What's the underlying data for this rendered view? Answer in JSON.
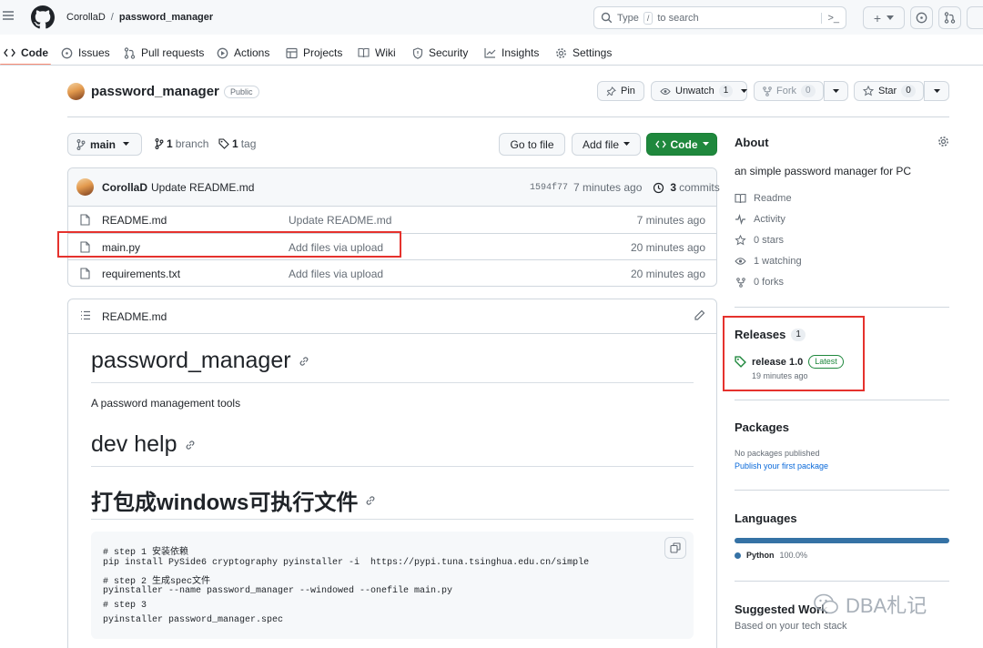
{
  "header": {
    "owner": "CorollaD",
    "separator": "/",
    "repo": "password_manager",
    "search_type": "Type",
    "search_key": "/",
    "search_rest": "to search",
    "terminal_label": ">_",
    "plus_label": "+"
  },
  "tabs": [
    {
      "label": "Code",
      "icon": "code-icon"
    },
    {
      "label": "Issues",
      "icon": "issue-icon"
    },
    {
      "label": "Pull requests",
      "icon": "pull-request-icon"
    },
    {
      "label": "Actions",
      "icon": "play-icon"
    },
    {
      "label": "Projects",
      "icon": "table-icon"
    },
    {
      "label": "Wiki",
      "icon": "book-icon"
    },
    {
      "label": "Security",
      "icon": "shield-icon"
    },
    {
      "label": "Insights",
      "icon": "graph-icon"
    },
    {
      "label": "Settings",
      "icon": "gear-icon"
    }
  ],
  "repo_header": {
    "name": "password_manager",
    "visibility": "Public",
    "pin_label": "Pin",
    "unwatch_label": "Unwatch",
    "unwatch_count": "1",
    "fork_label": "Fork",
    "fork_count": "0",
    "star_label": "Star",
    "star_count": "0"
  },
  "toolbar": {
    "branch_label": "main",
    "branches_count": "1",
    "branches_label": "branch",
    "tags_count": "1",
    "tags_label": "tag",
    "goto_file": "Go to file",
    "add_file": "Add file",
    "code_label": "Code"
  },
  "commit": {
    "author": "CorollaD",
    "message": "Update README.md",
    "hash": "1594f77",
    "time": "7 minutes ago",
    "commits_count": "3",
    "commits_label": "commits"
  },
  "files": [
    {
      "name": "README.md",
      "message": "Update README.md",
      "time": "7 minutes ago"
    },
    {
      "name": "main.py",
      "message": "Add files via upload",
      "time": "20 minutes ago"
    },
    {
      "name": "requirements.txt",
      "message": "Add files via upload",
      "time": "20 minutes ago"
    }
  ],
  "readme": {
    "file_label": "README.md",
    "h1": "password_manager",
    "p1": "A password management tools",
    "h2": "dev help",
    "h3": "打包成windows可执行文件",
    "code": [
      "# step 1 安装依赖",
      "pip install PySide6 cryptography pyinstaller -i  https://pypi.tuna.tsinghua.edu.cn/simple",
      "# step 2 生成spec文件",
      "pyinstaller --name password_manager --windowed --onefile main.py",
      "# step 3",
      "pyinstaller password_manager.spec"
    ]
  },
  "sidebar": {
    "about_title": "About",
    "description": "an simple password manager for PC",
    "items": [
      {
        "label": "Readme",
        "icon": "book-icon"
      },
      {
        "label": "Activity",
        "icon": "pulse-icon"
      },
      {
        "label": "0 stars",
        "icon": "star-icon"
      },
      {
        "label": "1 watching",
        "icon": "eye-icon"
      },
      {
        "label": "0 forks",
        "icon": "fork-icon"
      }
    ],
    "releases_title": "Releases",
    "releases_count": "1",
    "release_name": "release 1.0",
    "release_badge": "Latest",
    "release_time": "19 minutes ago",
    "packages_title": "Packages",
    "packages_none": "No packages published",
    "packages_link": "Publish your first package",
    "languages_title": "Languages",
    "language_name": "Python",
    "language_percent": "100.0%",
    "language_value": 100.0,
    "suggested_title": "Suggested Work",
    "suggested_sub": "Based on your tech stack"
  },
  "watermark": "DBA札记",
  "colors": {
    "accent_green": "#1f883d",
    "python_blue": "#3572a5",
    "highlight_red": "#e5322d",
    "link_blue": "#0969da",
    "tab_underline": "#fd8c73"
  }
}
